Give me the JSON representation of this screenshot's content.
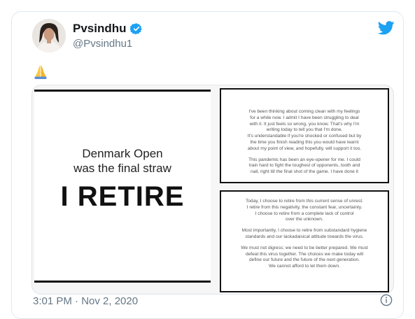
{
  "tweet": {
    "name": "Pvsindhu",
    "handle": "@Pvsindhu1",
    "text": "🙏",
    "timestamp": "3:01 PM · Nov 2, 2020"
  },
  "media": {
    "left": {
      "subhead_line1": "Denmark Open",
      "subhead_line2": "was the final straw",
      "headline": "I RETIRE"
    },
    "right_top": {
      "paragraphs": [
        "I've been thinking about coming clean with my feelings\nfor a while now. I admit I have been struggling to deal\nwith it. It just feels so wrong, you know. That's why I'm\nwriting today to tell you that I'm done.\nIt's understandable if you're shocked or confused but by\nthe time you finish reading this you would have learnt\nabout my point of view, and hopefully, will support it too.",
        "This pandemic has been an eye-opener for me. I could\ntrain hard to fight the toughest of opponents, tooth and\nnail, right till the final shot of the game. I have done it"
      ]
    },
    "right_bottom": {
      "paragraphs": [
        "Today, I choose to retire from this current sense of unrest.\nI retire from this negativity, the constant fear, uncertainty.\nI choose to retire from a complete lack of control\nover the unknown.",
        "Most importantly, I choose to retire from substandard hygiene\nstandards and our lackadaisical attitude towards the virus.",
        "We must not digress; we need to be better prepared. We must\ndefeat this virus together. The choices we make today will\ndefine our future and the future of the next generation.\nWe cannot afford to let them down."
      ]
    }
  },
  "icons": {
    "verified": "verified-badge-icon",
    "bird": "twitter-bird-icon",
    "info": "info-icon",
    "emoji": "folded-hands-emoji"
  },
  "colors": {
    "twitter_blue": "#1da1f2",
    "secondary_text": "#657786",
    "border": "#e1e8ed"
  }
}
